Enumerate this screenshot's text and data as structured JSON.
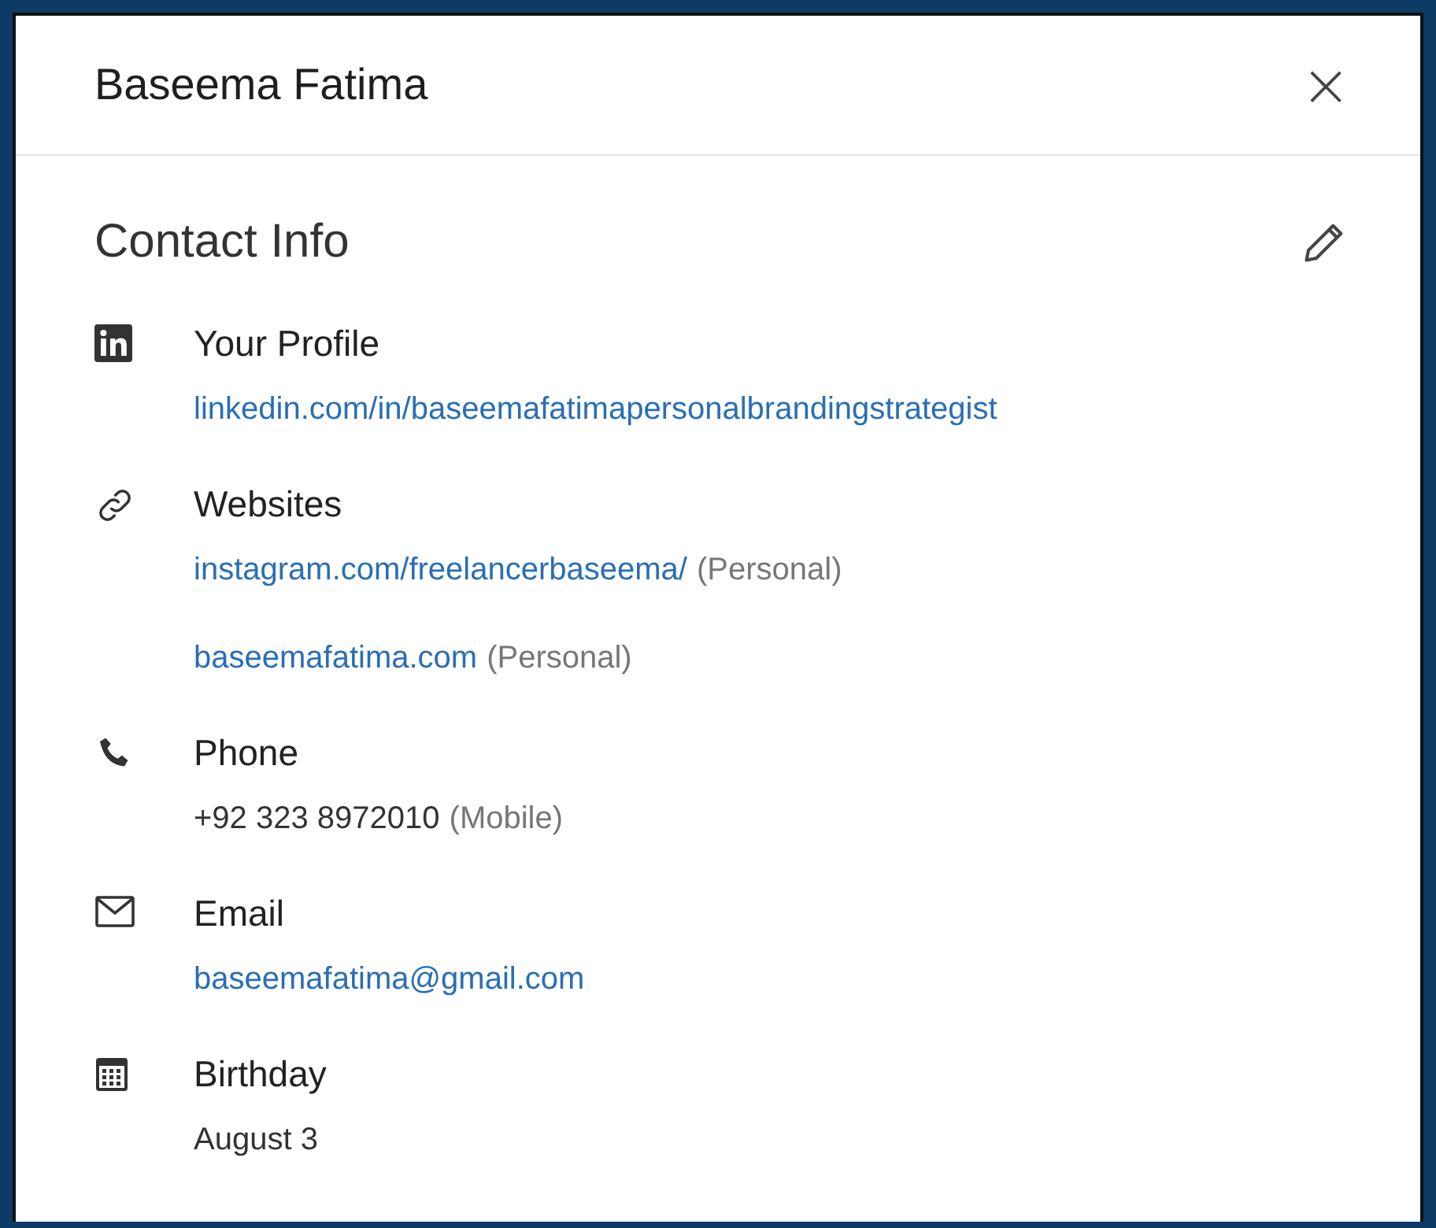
{
  "dialog": {
    "title": "Baseema Fatima",
    "close": "×"
  },
  "contact_info": {
    "heading": "Contact Info",
    "sections": [
      {
        "kind": "linkedin",
        "label": "Your Profile",
        "entries": [
          {
            "kind": "link",
            "value": "linkedin.com/in/baseemafatimapersonalbrandingstrategist"
          }
        ]
      },
      {
        "kind": "link",
        "label": "Websites",
        "entries": [
          {
            "kind": "link",
            "value": "instagram.com/freelancerbaseema/",
            "note": "(Personal)"
          },
          {
            "kind": "link",
            "value": "baseemafatima.com",
            "note": "(Personal)"
          }
        ]
      },
      {
        "kind": "phone",
        "label": "Phone",
        "entries": [
          {
            "kind": "text",
            "value": "+92 323 8972010",
            "note": "(Mobile)"
          }
        ]
      },
      {
        "kind": "email",
        "label": "Email",
        "entries": [
          {
            "kind": "link",
            "value": "baseemafatima@gmail.com"
          }
        ]
      },
      {
        "kind": "calendar",
        "label": "Birthday",
        "entries": [
          {
            "kind": "text",
            "value": "August 3"
          }
        ]
      }
    ]
  }
}
